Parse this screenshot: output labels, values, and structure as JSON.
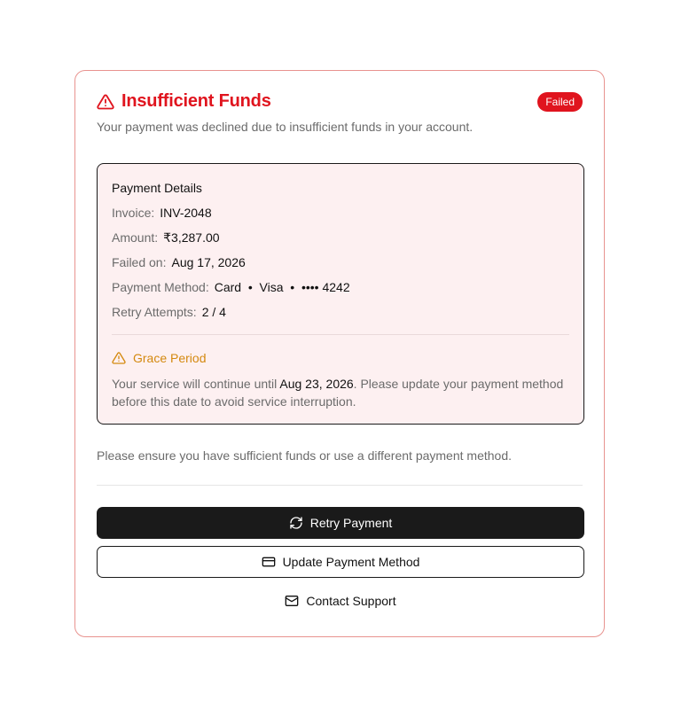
{
  "header": {
    "title": "Insufficient Funds",
    "status_badge": "Failed",
    "subtitle": "Your payment was declined due to insufficient funds in your account."
  },
  "details": {
    "title": "Payment Details",
    "rows": [
      {
        "label": "Invoice:",
        "value": "INV-2048"
      },
      {
        "label": "Amount:",
        "value": "₹3,287.00"
      },
      {
        "label": "Failed on:",
        "value": "Aug 17, 2026"
      },
      {
        "label": "Payment Method:",
        "value": "Card  •  Visa  •  •••• 4242"
      },
      {
        "label": "Retry Attempts:",
        "value": "2 / 4"
      }
    ],
    "grace": {
      "title": "Grace Period",
      "text_before": "Your service will continue until ",
      "date": "Aug 23, 2026",
      "text_after": ". Please update your payment method before this date to avoid service interruption."
    }
  },
  "note": "Please ensure you have sufficient funds or use a different payment method.",
  "actions": {
    "retry_label": "Retry Payment",
    "update_label": "Update Payment Method",
    "support_label": "Contact Support"
  },
  "colors": {
    "error": "#e0141e",
    "warning": "#d4890f",
    "card_border": "#e8938f",
    "details_bg": "#fdf0f1",
    "primary_button": "#1a1a1a"
  },
  "icons": {
    "title_icon": "alert-triangle-icon",
    "grace_icon": "alert-triangle-icon",
    "retry_icon": "refresh-icon",
    "update_icon": "credit-card-icon",
    "support_icon": "mail-icon"
  }
}
